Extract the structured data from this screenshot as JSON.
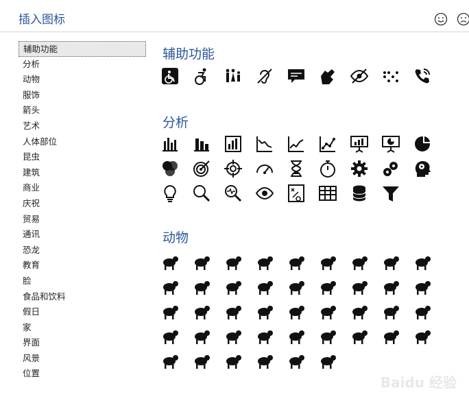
{
  "header": {
    "title": "插入图标"
  },
  "sidebar": {
    "categories": [
      "辅助功能",
      "分析",
      "动物",
      "服饰",
      "箭头",
      "艺术",
      "人体部位",
      "昆虫",
      "建筑",
      "商业",
      "庆祝",
      "贸易",
      "通讯",
      "恐龙",
      "教育",
      "脸",
      "食品和饮料",
      "假日",
      "家",
      "界面",
      "风景",
      "位置"
    ],
    "selected_index": 0
  },
  "sections": [
    {
      "title": "辅助功能",
      "icons": [
        "wheelchair-icon",
        "running-accessible-icon",
        "family-restroom-icon",
        "deaf-ear-icon",
        "captions-icon",
        "sign-language-icon",
        "low-vision-icon",
        "braille-icon",
        "hearing-phone-icon"
      ]
    },
    {
      "title": "分析",
      "icons": [
        "bar-chart-icon",
        "stacked-bar-chart-icon",
        "bar-chart-box-icon",
        "line-chart-down-icon",
        "line-chart-up-icon",
        "line-chart-points-icon",
        "presentation-chart-icon",
        "presentation-pie-icon",
        "pie-chart-icon",
        "venn-diagram-icon",
        "target-icon",
        "crosshair-icon",
        "gauge-icon",
        "hourglass-icon",
        "stopwatch-icon",
        "gear-icon",
        "gears-icon",
        "head-gears-icon",
        "lightbulb-icon",
        "magnifier-icon",
        "magnifier-pulse-icon",
        "eye-icon",
        "strategy-board-icon",
        "table-icon",
        "database-icon",
        "funnel-icon"
      ]
    },
    {
      "title": "动物",
      "icons": [
        "cat-icon",
        "dog-icon",
        "fishbowl-icon",
        "hamster-wheel-icon",
        "rabbit-icon",
        "mouse-icon",
        "snake-icon",
        "turtle-icon",
        "frog-icon",
        "crocodile-icon",
        "bats-icon",
        "bird-icon",
        "hummingbird-icon",
        "owl-icon",
        "peacock-icon",
        "duck-icon",
        "hen-icon",
        "rooster-icon",
        "cow-icon",
        "goat-icon",
        "horse-icon",
        "pig-icon",
        "sheep-icon",
        "deer-icon",
        "zebra-icon",
        "giraffe-icon",
        "elephant-icon",
        "rhino-icon",
        "hippo-icon",
        "lion-icon",
        "tiger-icon",
        "monkey-icon",
        "gorilla-icon",
        "panda-icon",
        "shell-icon",
        "fish-icon",
        "shark-icon",
        "whale-icon",
        "seal-icon",
        "crab-icon",
        "unicorn-icon",
        "paw-prints-icon"
      ]
    }
  ],
  "watermark": "Baidu 经验",
  "colors": {
    "accent": "#2b579a",
    "icon": "#111111"
  }
}
